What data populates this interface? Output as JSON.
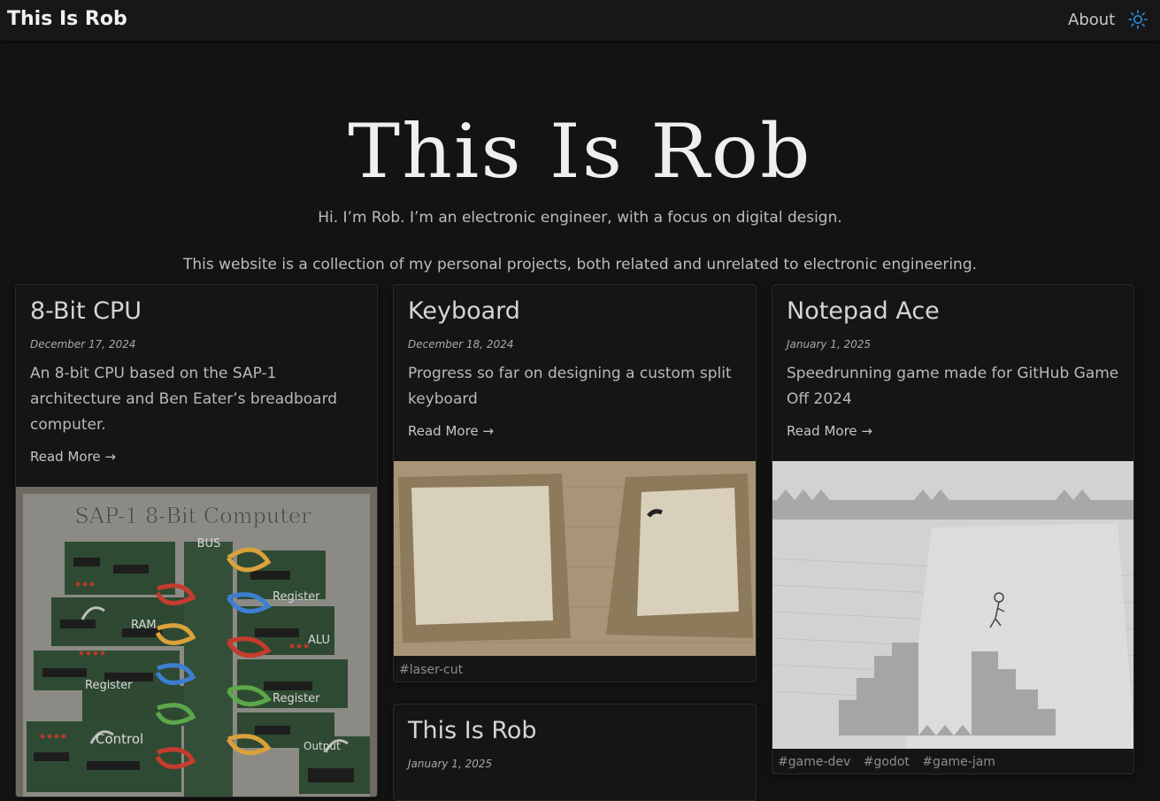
{
  "nav": {
    "brand": "This Is Rob",
    "about": "About",
    "theme_icon": "sun-icon",
    "accent_color": "#2f8fe0"
  },
  "hero": {
    "title": "This Is Rob",
    "intro": "Hi. I’m Rob. I’m an electronic engineer, with a focus on digital design.",
    "description": "This website is a collection of my personal projects, both related and unrelated to electronic engineering."
  },
  "cards": [
    {
      "title": "8-Bit CPU",
      "date": "December 17, 2024",
      "summary": "An 8-bit CPU based on the SAP-1 architecture and Ben Eater’s breadboard computer.",
      "read_more": "Read More →",
      "image_text": {
        "board_title": "SAP-1 8-Bit Computer",
        "bus": "BUS",
        "ram": "RAM",
        "register_a": "Register",
        "register_b": "Register",
        "register_top": "Register",
        "alu": "ALU",
        "control": "Control",
        "output": "Output"
      },
      "tags": []
    },
    {
      "title": "Keyboard",
      "date": "December 18, 2024",
      "summary": "Progress so far on designing a custom split keyboard",
      "read_more": "Read More →",
      "tags": [
        "#laser-cut"
      ]
    },
    {
      "title": "Notepad Ace",
      "date": "January 1, 2025",
      "summary": "Speedrunning game made for GitHub Game Off 2024",
      "read_more": "Read More →",
      "tags": [
        "#game-dev",
        "#godot",
        "#game-jam"
      ]
    },
    {
      "title": "This Is Rob",
      "date": "January 1, 2025",
      "tags": []
    }
  ]
}
